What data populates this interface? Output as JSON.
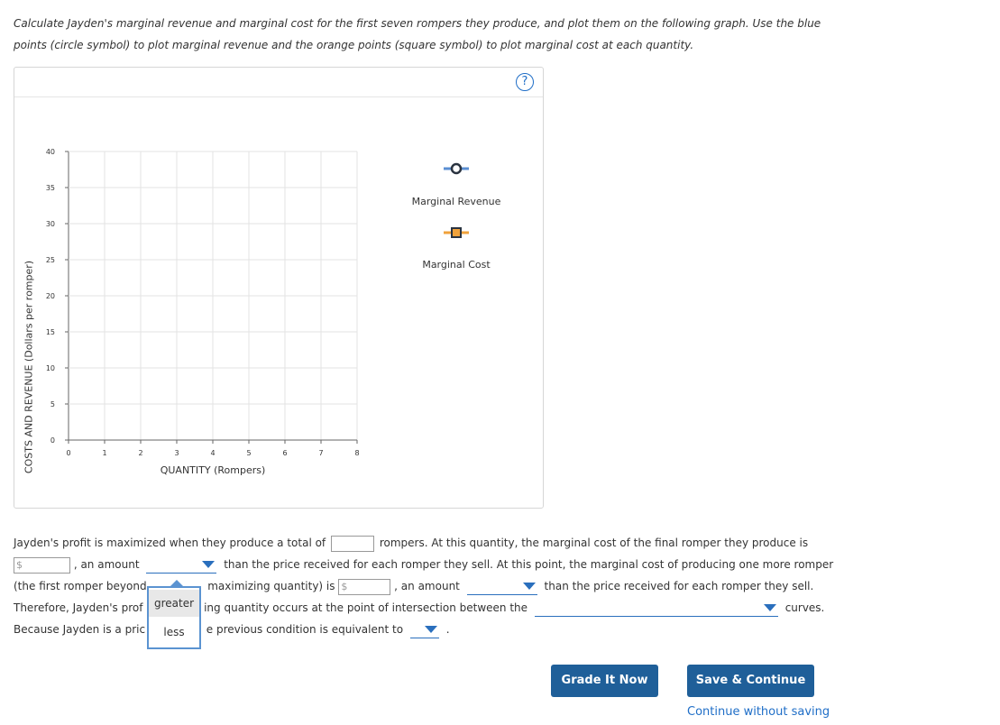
{
  "instructions": {
    "line1": "Calculate Jayden's marginal revenue and marginal cost for the first seven rompers they produce, and plot them on the following graph. Use the blue",
    "line2": "points (circle symbol) to plot marginal revenue and the orange points (square symbol) to plot marginal cost at each quantity."
  },
  "graph": {
    "help": "?",
    "y_label": "COSTS AND REVENUE (Dollars per romper)",
    "x_label": "QUANTITY (Rompers)",
    "y_ticks": [
      "40",
      "35",
      "30",
      "25",
      "20",
      "15",
      "10",
      "5",
      "0"
    ],
    "x_ticks": [
      "0",
      "1",
      "2",
      "3",
      "4",
      "5",
      "6",
      "7",
      "8"
    ],
    "legend": [
      {
        "label": "Marginal Revenue",
        "symbol": "circle",
        "color": "#5b8fd3"
      },
      {
        "label": "Marginal Cost",
        "symbol": "square",
        "color": "#f0a23b"
      }
    ]
  },
  "question": {
    "l1_a": "Jayden's profit is maximized when they produce a total of",
    "l1_b": "rompers. At this quantity, the marginal cost of the final romper they produce is",
    "dollar": "$",
    "l2_a": ", an amount",
    "l2_b": "than the price received for each romper they sell. At this point, the marginal cost of producing one more romper",
    "l3_a": "(the first romper beyond",
    "l3_b": "maximizing quantity) is",
    "l3_c": ", an amount",
    "l3_d": "than the price received for each romper they sell.",
    "l4_a": "Therefore, Jayden's prof",
    "l4_b": "ing quantity occurs at the point of intersection between the",
    "l4_c": "curves.",
    "l5_a": "Because Jayden is a pric",
    "l5_b": "e previous condition is equivalent to",
    "l5_c": "."
  },
  "dropdown_popup": {
    "options": [
      "greater",
      "less"
    ]
  },
  "buttons": {
    "grade": "Grade It Now",
    "save": "Save & Continue",
    "continue_link": "Continue without saving"
  }
}
